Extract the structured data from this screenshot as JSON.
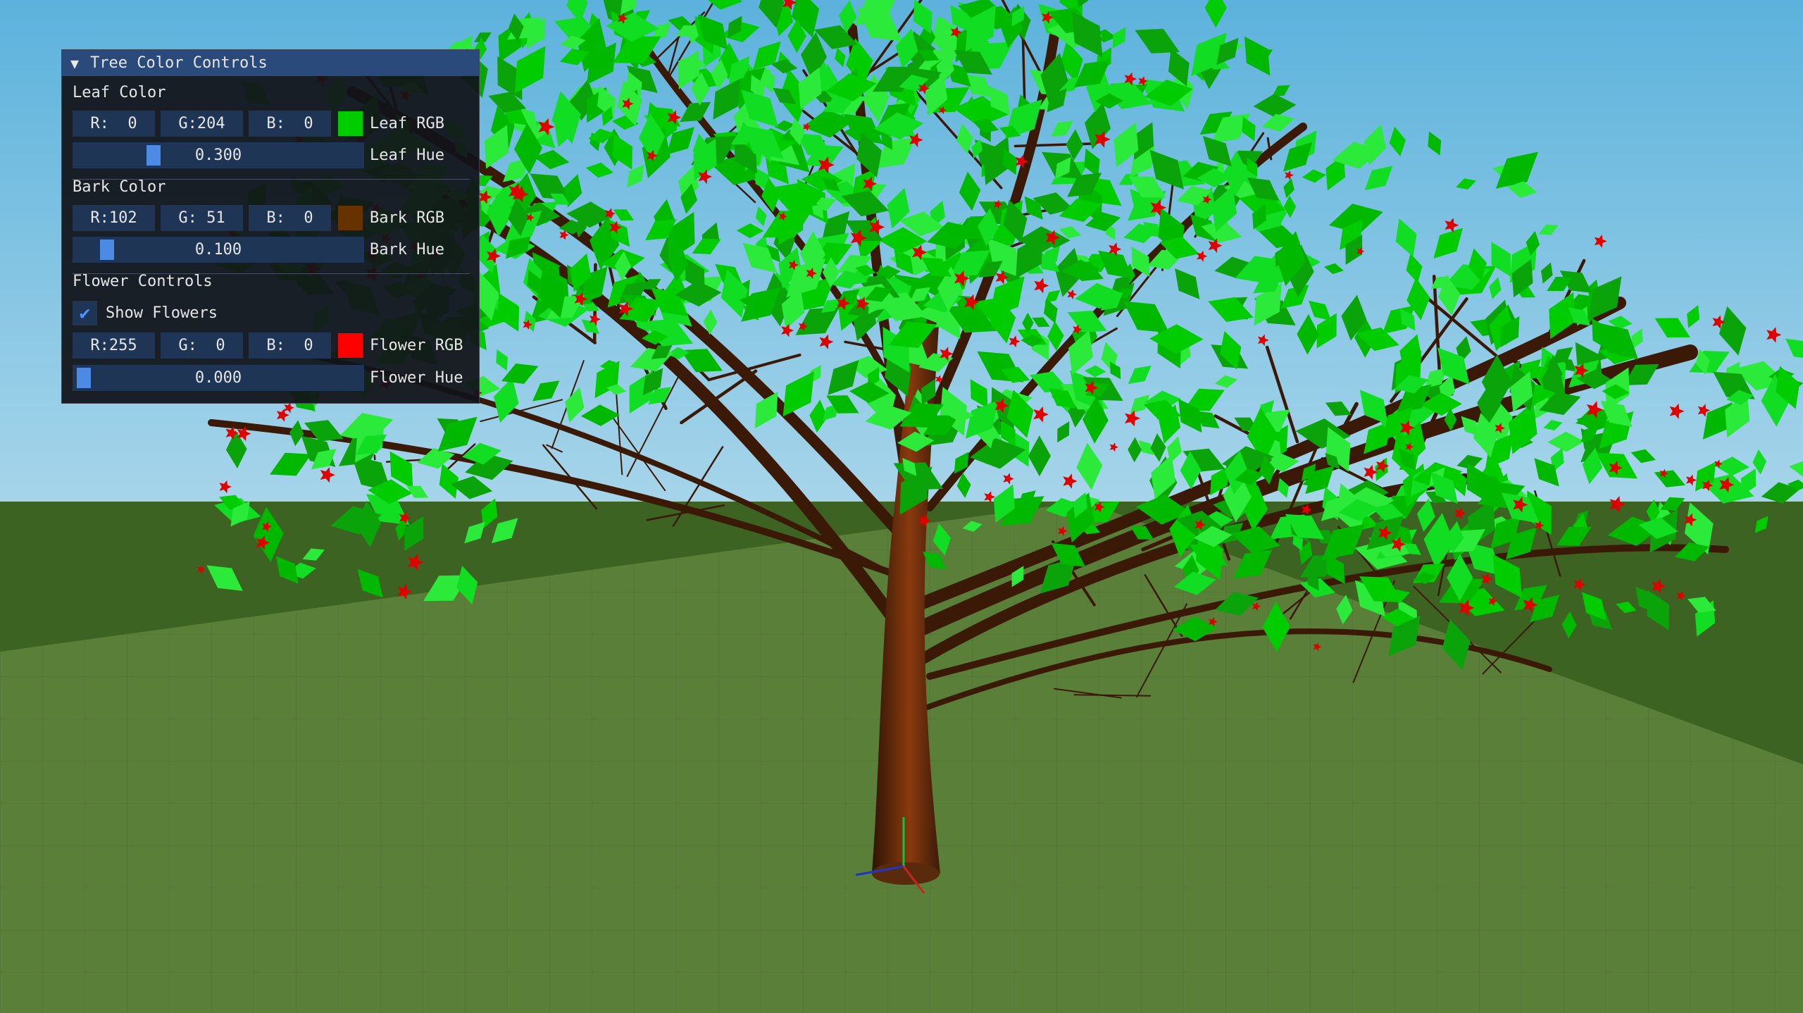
{
  "panel": {
    "title": "Tree Color Controls",
    "leaf": {
      "section": "Leaf Color",
      "r_text": "R:  0",
      "g_text": "G:204",
      "b_text": "B:  0",
      "swatch_color": "#00cc00",
      "rgb_label": "Leaf RGB",
      "hue_value": "0.300",
      "hue_level": 0.3,
      "hue_label": "Leaf Hue"
    },
    "bark": {
      "section": "Bark Color",
      "r_text": "R:102",
      "g_text": "G: 51",
      "b_text": "B:  0",
      "swatch_color": "#663300",
      "rgb_label": "Bark RGB",
      "hue_value": "0.100",
      "hue_level": 0.1,
      "hue_label": "Bark Hue"
    },
    "flower": {
      "section": "Flower Controls",
      "show_label": "Show Flowers",
      "show_checked": true,
      "r_text": "R:255",
      "g_text": "G:  0",
      "b_text": "B:  0",
      "swatch_color": "#ff0000",
      "rgb_label": "Flower RGB",
      "hue_value": "0.000",
      "hue_level": 0.0,
      "hue_label": "Flower Hue"
    }
  },
  "scene": {
    "sky_top": "#5fb4dc",
    "sky_bottom": "#a9d6ea",
    "ground_far": "#3e6422",
    "ground_near": "#557a33",
    "leaf_color": "#00cc00",
    "bark_color": "#663300",
    "flower_color": "#e00000"
  }
}
